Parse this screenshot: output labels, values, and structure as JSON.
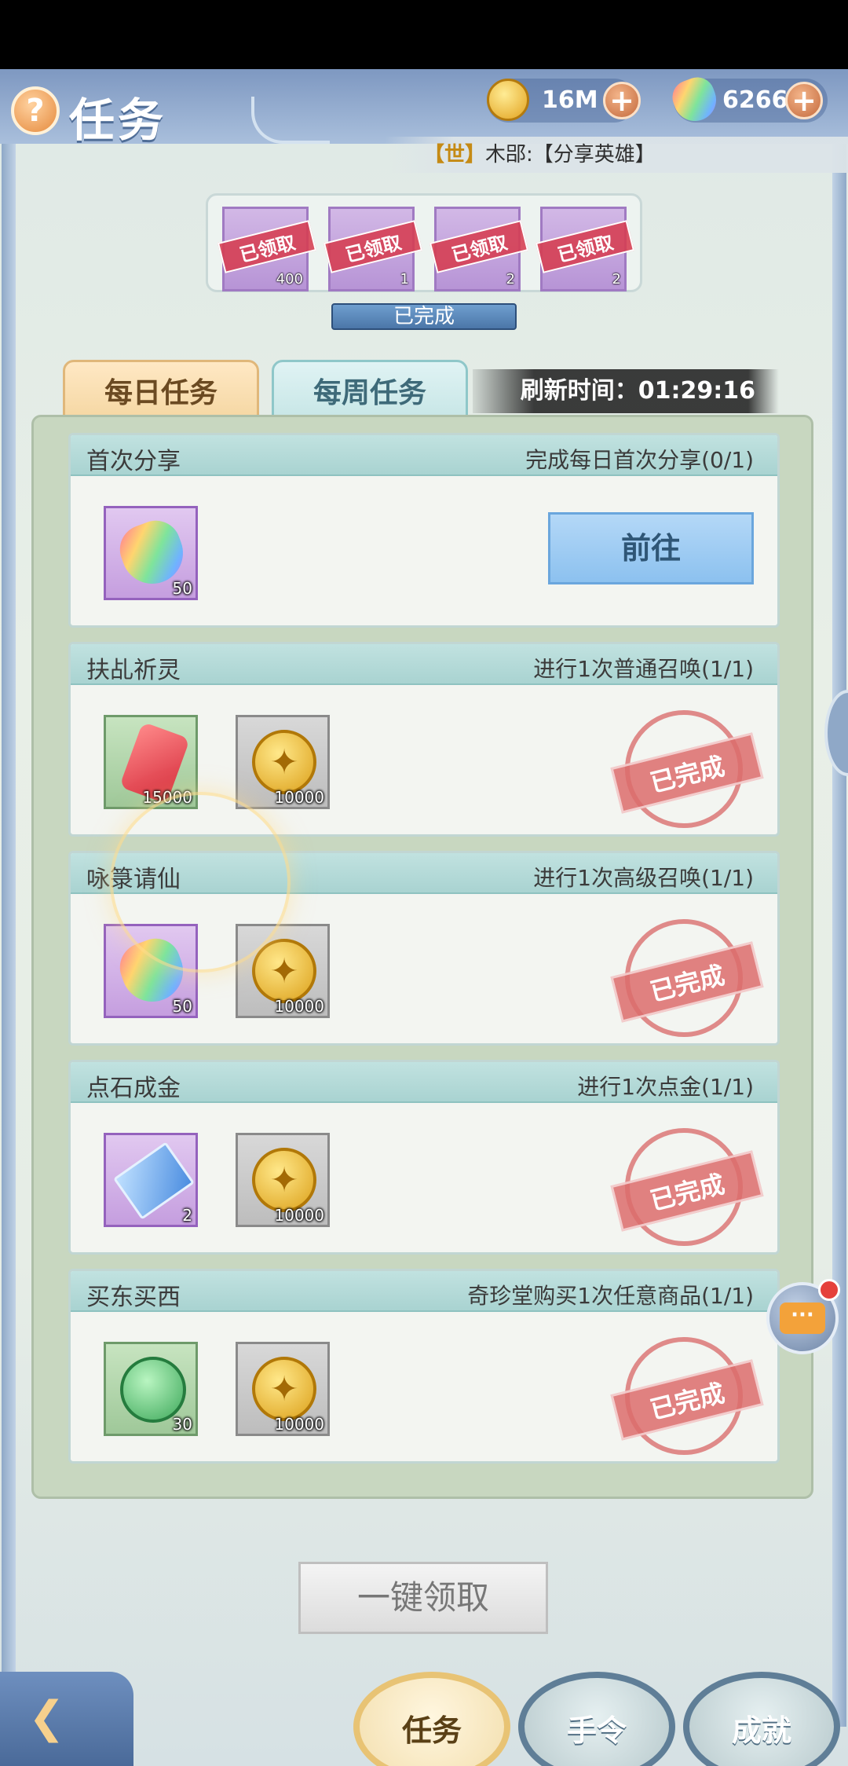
{
  "header": {
    "title": "任务",
    "help_icon": "help-icon",
    "coins": "16M",
    "gems": "6266",
    "plus": "+"
  },
  "broadcast": {
    "tag": "【世】",
    "text": "木郘:【分享英雄】"
  },
  "reward_strip": {
    "items": [
      {
        "stamp": "已领取",
        "count": "400"
      },
      {
        "stamp": "已领取",
        "count": "1"
      },
      {
        "stamp": "已领取",
        "count": "2"
      },
      {
        "stamp": "已领取",
        "count": "2"
      }
    ],
    "status": "已完成"
  },
  "tabs": {
    "daily": "每日任务",
    "weekly": "每周任务"
  },
  "refresh": {
    "label": "刷新时间：01:29:16"
  },
  "tasks": [
    {
      "name": "首次分享",
      "desc": "完成每日首次分享(0/1)",
      "rewards": [
        {
          "icon": "rainbow-gem-icon",
          "count": "50"
        }
      ],
      "action": "前往"
    },
    {
      "name": "扶乩祈灵",
      "desc": "进行1次普通召唤(1/1)",
      "rewards": [
        {
          "icon": "red-gem-icon",
          "count": "15000"
        },
        {
          "icon": "gold-coin-icon",
          "count": "10000"
        }
      ],
      "status": "已完成"
    },
    {
      "name": "咏箓请仙",
      "desc": "进行1次高级召唤(1/1)",
      "rewards": [
        {
          "icon": "rainbow-gem-icon",
          "count": "50"
        },
        {
          "icon": "gold-coin-icon",
          "count": "10000"
        }
      ],
      "status": "已完成"
    },
    {
      "name": "点石成金",
      "desc": "进行1次点金(1/1)",
      "rewards": [
        {
          "icon": "scroll-icon",
          "count": "2"
        },
        {
          "icon": "gold-coin-icon",
          "count": "10000"
        }
      ],
      "status": "已完成"
    },
    {
      "name": "买东买西",
      "desc": "奇珍堂购买1次任意商品(1/1)",
      "rewards": [
        {
          "icon": "green-token-icon",
          "count": "30"
        },
        {
          "icon": "gold-coin-icon",
          "count": "10000"
        }
      ],
      "status": "已完成"
    }
  ],
  "claim_all": "一键领取",
  "chat_bubble": "···",
  "bottom_nav": {
    "tasks": "任务",
    "orders": "手令",
    "achievements": "成就"
  },
  "colors": {
    "header": "#7e98c1",
    "tab_daily": "#f5d7a3",
    "tab_weekly": "#c7e6e6",
    "done_stamp": "#dc6c6c",
    "go_button": "#8cc1ef"
  }
}
